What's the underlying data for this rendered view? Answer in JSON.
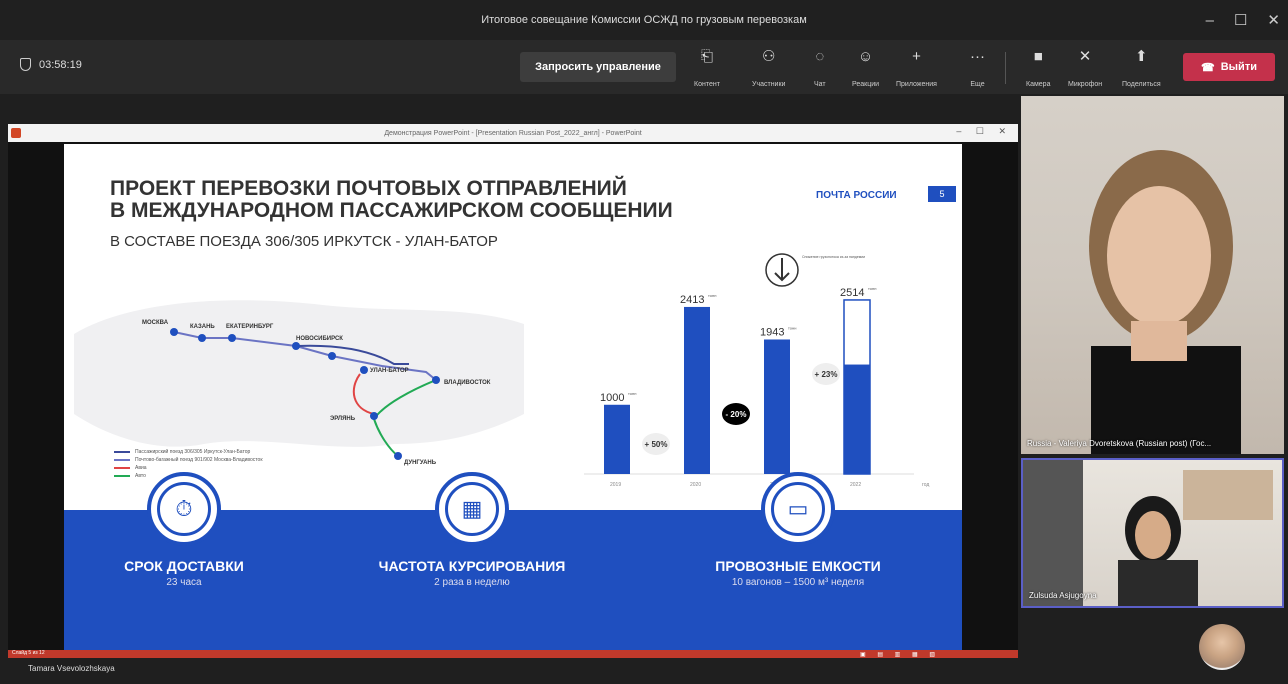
{
  "window": {
    "title": "Итоговое совещание Комиссии ОСЖД по грузовым перевозкам",
    "controls": [
      "–",
      "☐",
      "✕"
    ]
  },
  "toolbar": {
    "timer": "03:58:19",
    "request_control": "Запросить управление",
    "items": [
      {
        "label": "Контент",
        "icon": "⎗"
      },
      {
        "label": "Участники",
        "icon": "⚇"
      },
      {
        "label": "Чат",
        "icon": "◌"
      },
      {
        "label": "Реакции",
        "icon": "☺"
      },
      {
        "label": "Приложения",
        "icon": "+"
      },
      {
        "label": "Еще",
        "icon": "···"
      },
      {
        "label": "Камера",
        "icon": "■"
      },
      {
        "label": "Микрофон",
        "icon": "✕"
      },
      {
        "label": "Поделиться",
        "icon": "⬆"
      }
    ],
    "leave": "Выйти"
  },
  "ppt": {
    "title": "Демонстрация PowerPoint - [Presentation Russian Post_2022_англ] - PowerPoint",
    "slide_status": "Слайд 5 из 12"
  },
  "slide": {
    "title_line1": "ПРОЕКТ ПЕРЕВОЗКИ ПОЧТОВЫХ ОТПРАВЛЕНИЙ",
    "title_line2": "В МЕЖДУНАРОДНОМ ПАССАЖИРСКОМ СООБЩЕНИИ",
    "subtitle": "В СОСТАВЕ ПОЕЗДА 306/305 ИРКУТСК - УЛАН-БАТОР",
    "logo": "ПОЧТА РОССИИ",
    "page": "5",
    "cities": [
      "МОСКВА",
      "КАЗАНЬ",
      "ЕКАТЕРИНБУРГ",
      "НОВОСИБИРСК",
      "УЛАН-БАТОР",
      "ВЛАДИВОСТОК",
      "ЭРЛЯНЬ",
      "ДУНГУАНЬ"
    ],
    "legend": [
      {
        "label": "Пассажирский поезд 306/305 Иркутск-Улан-Батор",
        "color": "#3a4a9a"
      },
      {
        "label": "Почтово-багажный поезд 901/902 Москва-Владивосток",
        "color": "#6b74c4"
      },
      {
        "label": "Авиа",
        "color": "#e04444"
      },
      {
        "label": "Авто",
        "color": "#22aa55"
      }
    ],
    "decline_note": "Снижение грузопотока из-за пандемии",
    "features": [
      {
        "title": "СРОК ДОСТАВКИ",
        "sub": "23 часа",
        "icon": "⏱"
      },
      {
        "title": "ЧАСТОТА КУРСИРОВАНИЯ",
        "sub": "2 раза в неделю",
        "icon": "▦"
      },
      {
        "title": "ПРОВОЗНЫЕ ЕМКОСТИ",
        "sub": "10 вагонов – 1500 м³ неделя",
        "icon": "▭"
      }
    ]
  },
  "chart_data": {
    "type": "bar",
    "categories": [
      "2019",
      "2020",
      "2021",
      "2022"
    ],
    "values": [
      1000,
      2413,
      1943,
      2514
    ],
    "filled_portion_2022": 1581,
    "unit": "тонн",
    "changes": [
      "+ 50%",
      "- 20%",
      "+ 23%"
    ],
    "ylim": [
      0,
      2600
    ],
    "xlabel": "год",
    "ylabel": ""
  },
  "participants": {
    "video1": "Russia - Valeriya Dvoretskova (Russian post) (Гос...",
    "video2": "Zulsuda Asjugoyna",
    "presenter": "Tamara Vsevolozhskaya"
  },
  "colors": {
    "accent": "#1f4fbf",
    "leave": "#c4314b"
  }
}
